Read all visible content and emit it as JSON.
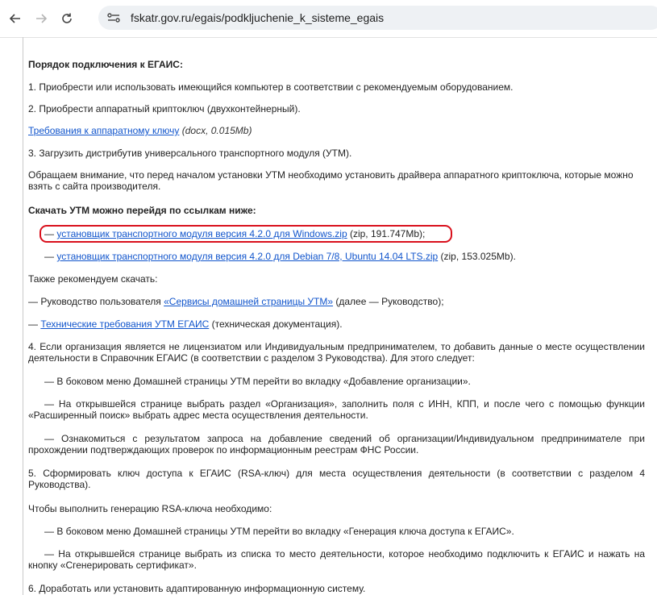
{
  "browser": {
    "url": "fskatr.gov.ru/egais/podkljuchenie_k_sisteme_egais",
    "icons": [
      "back-arrow-icon",
      "forward-arrow-icon",
      "reload-icon",
      "site-info-icon"
    ]
  },
  "page": {
    "heading": "Порядок подключения к ЕГАИС:",
    "step1": "1. Приобрести или использовать имеющийся компьютер в соответствии с рекомендуемым оборудованием.",
    "step2": "2. Приобрести аппаратный криптоключ (двухконтейнерный).",
    "key_req_link": "Требования к аппаратному ключу",
    "key_req_meta": "(docx, 0.015Mb)",
    "step3": "3. Загрузить дистрибутив универсального транспортного модуля (УТМ).",
    "notice": "Обращаем внимание, что перед началом установки УТМ необходимо установить драйвера аппаратного криптоключа, которые можно взять с сайта производителя.",
    "download_heading": "Скачать УТМ можно перейдя по ссылкам ниже:",
    "dash": "— ",
    "download_windows_link": "установщик транспортного модуля версия 4.2.0 для Windows.zip",
    "download_windows_meta": "(zip, 191.747Mb);",
    "download_linux_link": "установщик транспортного модуля версия 4.2.0 для Debian 7/8, Ubuntu 14.04 LTS.zip",
    "download_linux_meta": "(zip, 153.025Mb).",
    "also_recommend": "Также рекомендуем скачать:",
    "guide_prefix": "— Руководство пользователя ",
    "guide_link": "«Сервисы домашней страницы УТМ»",
    "guide_suffix": " (далее — Руководство);",
    "tech_req_link": "Технические требования УТМ ЕГАИС",
    "tech_req_suffix": " (техническая документация).",
    "step4": "4. Если организация является не лицензиатом или Индивидуальным предпринимателем, то добавить данные о месте осуществлении деятельности в Справочник ЕГАИС (в соответствии с разделом 3 Руководства). Для этого следует:",
    "step4_a": "— В боковом меню Домашней страницы УТМ перейти во вкладку «Добавление организации».",
    "step4_b": "— На открывшейся странице выбрать раздел «Организация», заполнить поля с ИНН, КПП, и после чего с помощью функции «Расширенный поиск» выбрать адрес       места осуществления деятельности.",
    "step4_c": "— Ознакомиться с результатом запроса на добавление сведений об организации/Индивидуальном предпринимателе при прохождении подтверждающих проверок          по информационным реестрам ФНС России.",
    "step5": "5. Сформировать ключ доступа к ЕГАИС (RSA-ключ) для места осуществления деятельности (в соответствии с разделом 4 Руководства).",
    "rsa_intro": "Чтобы выполнить генерацию RSA-ключа необходимо:",
    "rsa_a": "— В боковом меню Домашней страницы УТМ перейти во вкладку «Генерация ключа доступа к ЕГАИС».",
    "rsa_b": "— На открывшейся странице выбрать из списка то место деятельности, которое необходимо подключить к ЕГАИС и нажать на кнопку «Сгенерировать сертификат».",
    "step6": "6. Доработать или установить адаптированную информационную систему."
  },
  "colors": {
    "link": "#1155cc",
    "highlight_circle": "#d9101c",
    "urlbar_bg": "#eef1f4"
  }
}
